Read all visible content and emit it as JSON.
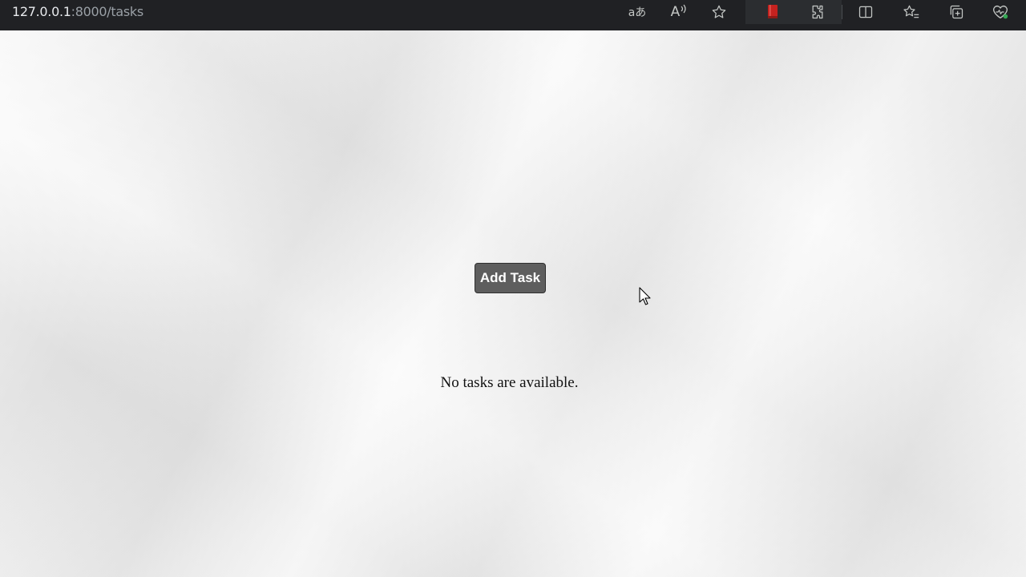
{
  "browser": {
    "url_host": "127.0.0.1",
    "url_path": ":8000/tasks",
    "icons": [
      "translate-icon",
      "read-aloud-icon",
      "favorite-star-icon",
      "reading-list-icon",
      "extensions-icon",
      "split-screen-icon",
      "favorites-icon",
      "collections-icon",
      "browser-essentials-icon"
    ],
    "read_aloud_label": "A",
    "translate_label": "aあ"
  },
  "main": {
    "add_task_label": "Add Task",
    "empty_message": "No tasks are available."
  },
  "colors": {
    "toolbar_bg": "#202124",
    "button_bg": "#5e5e5e",
    "button_text": "#ffffff",
    "page_bg": "#ececec",
    "reading_list_accent": "#c5221f",
    "status_dot": "#34a853"
  }
}
